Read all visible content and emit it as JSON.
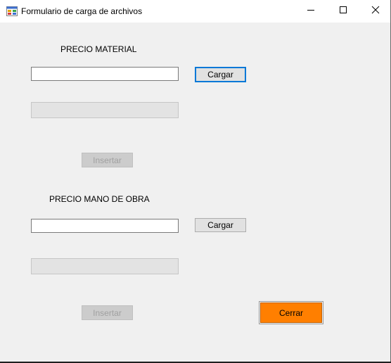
{
  "window": {
    "title": "Formulario de carga de archivos",
    "icon": "form-app-icon",
    "controls": {
      "minimize": "minimize-icon",
      "maximize": "maximize-icon",
      "close": "close-icon"
    }
  },
  "material": {
    "label": "PRECIO MATERIAL",
    "input_value": "",
    "output_value": "",
    "load_button": "Cargar",
    "insert_button": "Insertar"
  },
  "mano_obra": {
    "label": "PRECIO MANO DE OBRA",
    "input_value": "",
    "output_value": "",
    "load_button": "Cargar",
    "insert_button": "Insertar"
  },
  "close_button": "Cerrar",
  "colors": {
    "close_button_bg": "#ff7f00",
    "focus_border": "#0078d7",
    "window_bg": "#f0f0f0"
  }
}
